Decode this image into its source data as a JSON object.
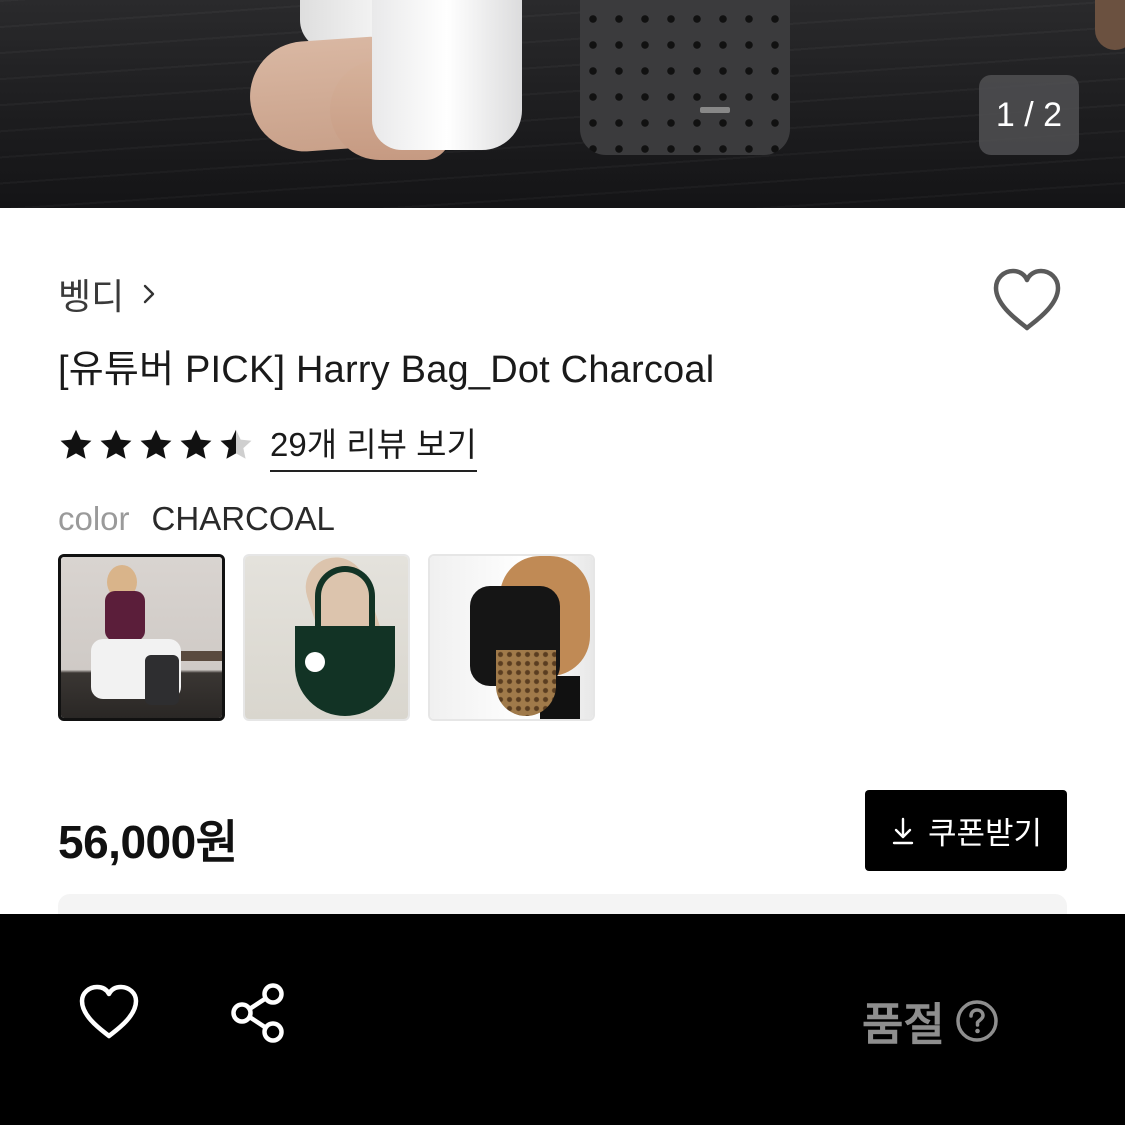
{
  "hero": {
    "image_counter": "1 / 2"
  },
  "product": {
    "brand": "벵디",
    "title": "[유튜버 PICK] Harry Bag_Dot Charcoal",
    "rating": 4.5,
    "review_link": "29개 리뷰 보기",
    "color_label": "color",
    "color_value": "CHARCOAL",
    "thumbnails": [
      "charcoal-dot-bag",
      "green-bag",
      "leopard-bag"
    ],
    "selected_thumbnail": 0,
    "price": "56,000원",
    "coupon_label": "쿠폰받기"
  },
  "bottom_bar": {
    "status": "품절"
  },
  "colors": {
    "accent": "#000000",
    "status_text": "#8e8e8e",
    "star": "#111111"
  },
  "icons": [
    "chevron-right-icon",
    "heart-outline-icon",
    "star-icon",
    "half-star-icon",
    "download-icon",
    "share-icon",
    "question-circle-icon"
  ]
}
